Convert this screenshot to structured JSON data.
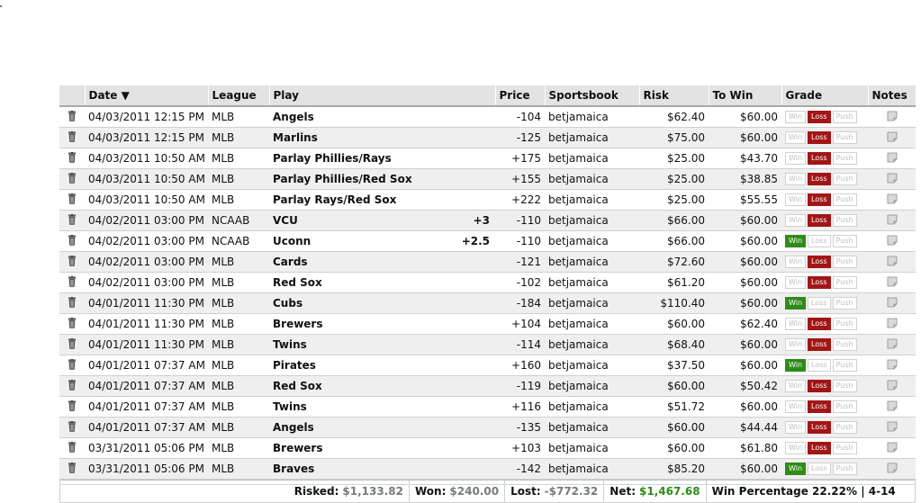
{
  "columns": {
    "date": "Date ▼",
    "league": "League",
    "play": "Play",
    "price": "Price",
    "sportsbook": "Sportsbook",
    "risk": "Risk",
    "to_win": "To Win",
    "grade": "Grade",
    "notes": "Notes"
  },
  "grade_labels": {
    "win": "Win",
    "loss": "Loss",
    "push": "Push"
  },
  "colors": {
    "win": "#2e8b16",
    "loss": "#a31515",
    "header_bg": "#e3e3e3",
    "row_alt": "#efefef"
  },
  "rows": [
    {
      "date": "04/03/2011 12:15 PM",
      "league": "MLB",
      "play": "Angels",
      "line": "",
      "price": "-104",
      "book": "betjamaica",
      "risk": "$62.40",
      "to_win": "$60.00",
      "grade": "loss"
    },
    {
      "date": "04/03/2011 12:15 PM",
      "league": "MLB",
      "play": "Marlins",
      "line": "",
      "price": "-125",
      "book": "betjamaica",
      "risk": "$75.00",
      "to_win": "$60.00",
      "grade": "loss"
    },
    {
      "date": "04/03/2011 10:50 AM",
      "league": "MLB",
      "play": "Parlay Phillies/Rays",
      "line": "",
      "price": "+175",
      "book": "betjamaica",
      "risk": "$25.00",
      "to_win": "$43.70",
      "grade": "loss"
    },
    {
      "date": "04/03/2011 10:50 AM",
      "league": "MLB",
      "play": "Parlay Phillies/Red Sox",
      "line": "",
      "price": "+155",
      "book": "betjamaica",
      "risk": "$25.00",
      "to_win": "$38.85",
      "grade": "loss"
    },
    {
      "date": "04/03/2011 10:50 AM",
      "league": "MLB",
      "play": "Parlay Rays/Red Sox",
      "line": "",
      "price": "+222",
      "book": "betjamaica",
      "risk": "$25.00",
      "to_win": "$55.55",
      "grade": "loss"
    },
    {
      "date": "04/02/2011 03:00 PM",
      "league": "NCAAB",
      "play": "VCU",
      "line": "+3",
      "price": "-110",
      "book": "betjamaica",
      "risk": "$66.00",
      "to_win": "$60.00",
      "grade": "loss"
    },
    {
      "date": "04/02/2011 03:00 PM",
      "league": "NCAAB",
      "play": "Uconn",
      "line": "+2.5",
      "price": "-110",
      "book": "betjamaica",
      "risk": "$66.00",
      "to_win": "$60.00",
      "grade": "win"
    },
    {
      "date": "04/02/2011 03:00 PM",
      "league": "MLB",
      "play": "Cards",
      "line": "",
      "price": "-121",
      "book": "betjamaica",
      "risk": "$72.60",
      "to_win": "$60.00",
      "grade": "loss"
    },
    {
      "date": "04/02/2011 03:00 PM",
      "league": "MLB",
      "play": "Red Sox",
      "line": "",
      "price": "-102",
      "book": "betjamaica",
      "risk": "$61.20",
      "to_win": "$60.00",
      "grade": "loss"
    },
    {
      "date": "04/01/2011 11:30 PM",
      "league": "MLB",
      "play": "Cubs",
      "line": "",
      "price": "-184",
      "book": "betjamaica",
      "risk": "$110.40",
      "to_win": "$60.00",
      "grade": "win"
    },
    {
      "date": "04/01/2011 11:30 PM",
      "league": "MLB",
      "play": "Brewers",
      "line": "",
      "price": "+104",
      "book": "betjamaica",
      "risk": "$60.00",
      "to_win": "$62.40",
      "grade": "loss"
    },
    {
      "date": "04/01/2011 11:30 PM",
      "league": "MLB",
      "play": "Twins",
      "line": "",
      "price": "-114",
      "book": "betjamaica",
      "risk": "$68.40",
      "to_win": "$60.00",
      "grade": "loss"
    },
    {
      "date": "04/01/2011 07:37 AM",
      "league": "MLB",
      "play": "Pirates",
      "line": "",
      "price": "+160",
      "book": "betjamaica",
      "risk": "$37.50",
      "to_win": "$60.00",
      "grade": "win"
    },
    {
      "date": "04/01/2011 07:37 AM",
      "league": "MLB",
      "play": "Red Sox",
      "line": "",
      "price": "-119",
      "book": "betjamaica",
      "risk": "$60.00",
      "to_win": "$50.42",
      "grade": "loss"
    },
    {
      "date": "04/01/2011 07:37 AM",
      "league": "MLB",
      "play": "Twins",
      "line": "",
      "price": "+116",
      "book": "betjamaica",
      "risk": "$51.72",
      "to_win": "$60.00",
      "grade": "loss"
    },
    {
      "date": "04/01/2011 07:37 AM",
      "league": "MLB",
      "play": "Angels",
      "line": "",
      "price": "-135",
      "book": "betjamaica",
      "risk": "$60.00",
      "to_win": "$44.44",
      "grade": "loss"
    },
    {
      "date": "03/31/2011 05:06 PM",
      "league": "MLB",
      "play": "Brewers",
      "line": "",
      "price": "+103",
      "book": "betjamaica",
      "risk": "$60.00",
      "to_win": "$61.80",
      "grade": "loss"
    },
    {
      "date": "03/31/2011 05:06 PM",
      "league": "MLB",
      "play": "Braves",
      "line": "",
      "price": "-142",
      "book": "betjamaica",
      "risk": "$85.20",
      "to_win": "$60.00",
      "grade": "win"
    }
  ],
  "summary": {
    "risked_label": "Risked:",
    "risked_value": "$1,133.82",
    "won_label": "Won:",
    "won_value": "$240.00",
    "lost_label": "Lost:",
    "lost_value": "-$772.32",
    "net_label": "Net:",
    "net_value": "$1,467.68",
    "win_pct": "Win Percentage 22.22% | 4-14"
  }
}
